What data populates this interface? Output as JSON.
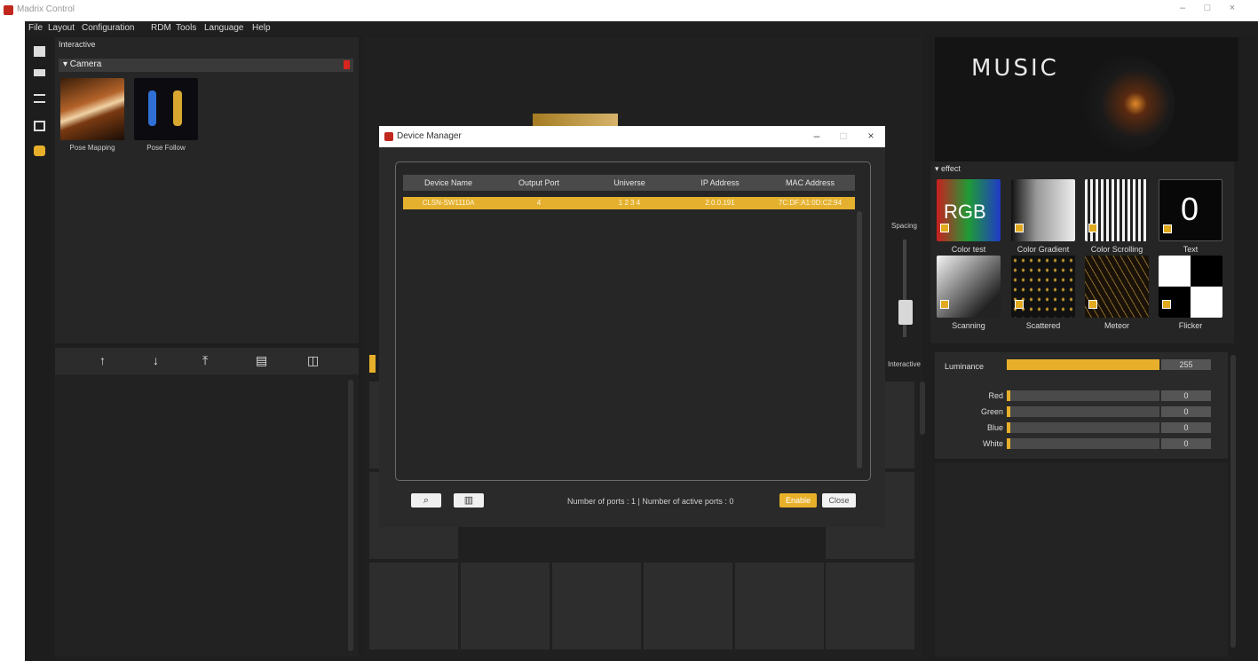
{
  "app": {
    "title": "Madrix Control"
  },
  "window_controls": {
    "minimize": "–",
    "maximize": "□",
    "close": "×"
  },
  "menu": [
    "File",
    "Layout",
    "Configuration",
    "RDM",
    "Tools",
    "Language",
    "Help"
  ],
  "library": {
    "header": "Interactive",
    "group_label": "▾ Camera",
    "items": [
      "Pose Mapping",
      "Pose Follow"
    ]
  },
  "order_toolbar": {
    "up": "↑",
    "down": "↓",
    "top": "⤒",
    "delete": "▤",
    "grid": "◫"
  },
  "dialog": {
    "title": "Device Manager",
    "columns": [
      "Device Name",
      "Output Port",
      "Universe",
      "IP Address",
      "MAC Address"
    ],
    "rows": [
      {
        "device_name": "CLSN-SW1110A",
        "output_port": "4",
        "universe": "1   2   3   4",
        "ip": "2.0.0.191",
        "mac": "7C:DF:A1:0D:C2:94"
      }
    ],
    "search_icon_glyph": "⌕",
    "delete_icon_glyph": "▥",
    "ports_text": "Number of ports :  1  | Number of active ports :  0",
    "enable_label": "Enable",
    "close_label": "Close"
  },
  "effects": {
    "header": "▾ effect",
    "items": [
      "Color test",
      "Color Gradient",
      "Color Scrolling",
      "Text",
      "Scanning",
      "Scattered",
      "Meteor",
      "Flicker"
    ],
    "rgb_text": "RGB",
    "zero_text": "0"
  },
  "spacing_label": "Spacing",
  "interactive_label": "Interactive",
  "luminance": {
    "label": "Luminance",
    "value": "255",
    "fraction": 1.0
  },
  "channels": [
    {
      "label": "Red",
      "value": "0",
      "fraction": 0.0
    },
    {
      "label": "Green",
      "value": "0",
      "fraction": 0.0
    },
    {
      "label": "Blue",
      "value": "0",
      "fraction": 0.0
    },
    {
      "label": "White",
      "value": "0",
      "fraction": 0.0
    }
  ],
  "preview_text": "MUSIC",
  "colors": {
    "accent": "#e8b02a",
    "panel": "#262626",
    "background": "#1e1e1e"
  }
}
